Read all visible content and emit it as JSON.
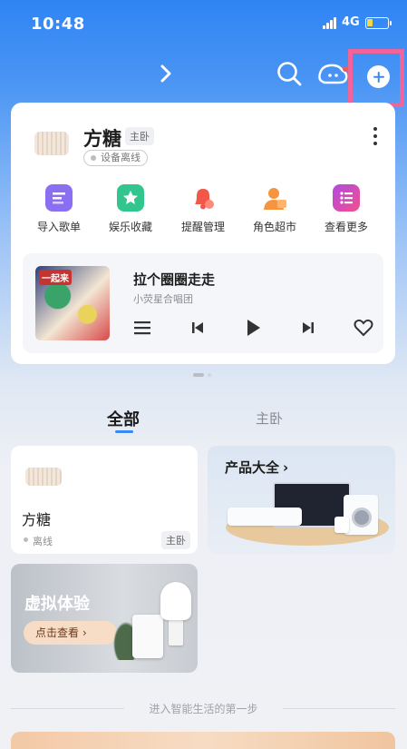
{
  "status_bar": {
    "time": "10:48",
    "network": "4G"
  },
  "device_card": {
    "name": "方糖",
    "room": "主卧",
    "status": "设备离线",
    "functions": [
      {
        "label": "导入歌单",
        "icon": "import-playlist-icon",
        "color": "#8b6ff2"
      },
      {
        "label": "娱乐收藏",
        "icon": "star-favorite-icon",
        "color": "#33c58e"
      },
      {
        "label": "提醒管理",
        "icon": "alarm-bell-icon",
        "color": "#f2574a"
      },
      {
        "label": "角色超市",
        "icon": "character-icon",
        "color": "#f59540"
      },
      {
        "label": "查看更多",
        "icon": "more-list-icon",
        "color": "#d04cd6"
      }
    ]
  },
  "player": {
    "cover_text": "一起来",
    "title": "拉个圈圈走走",
    "artist": "小荧星合唱团"
  },
  "tabs": [
    "全部",
    "主卧"
  ],
  "tiles": {
    "device": {
      "name": "方糖",
      "status": "离线",
      "room": "主卧"
    },
    "products": {
      "title": "产品大全",
      "arrow": "›"
    },
    "virtual": {
      "title": "虚拟体验",
      "button": "点击查看",
      "arrow": "›"
    }
  },
  "footer": {
    "text": "进入智能生活的第一步"
  }
}
